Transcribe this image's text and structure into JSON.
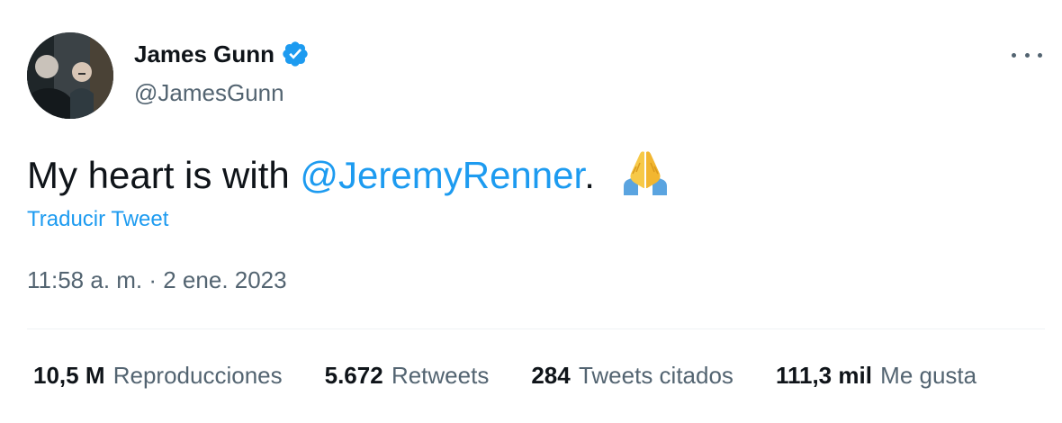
{
  "author": {
    "name": "James Gunn",
    "handle": "@JamesGunn",
    "verified": true,
    "avatar_icon": "profile-photo"
  },
  "tweet": {
    "text_before": "My heart is with ",
    "mention": "@JeremyRenner",
    "text_after": ".",
    "emoji_icon": "folded-hands-emoji"
  },
  "translate_label": "Traducir Tweet",
  "timestamp": "11:58 a. m. · 2 ene. 2023",
  "stats": [
    {
      "value": "10,5 M",
      "label": "Reproducciones"
    },
    {
      "value": "5.672",
      "label": "Retweets"
    },
    {
      "value": "284",
      "label": "Tweets citados"
    },
    {
      "value": "111,3 mil",
      "label": "Me gusta"
    }
  ],
  "colors": {
    "accent": "#1d9bf0",
    "text": "#0f1419",
    "secondary": "#536471",
    "divider": "#eff3f4"
  }
}
